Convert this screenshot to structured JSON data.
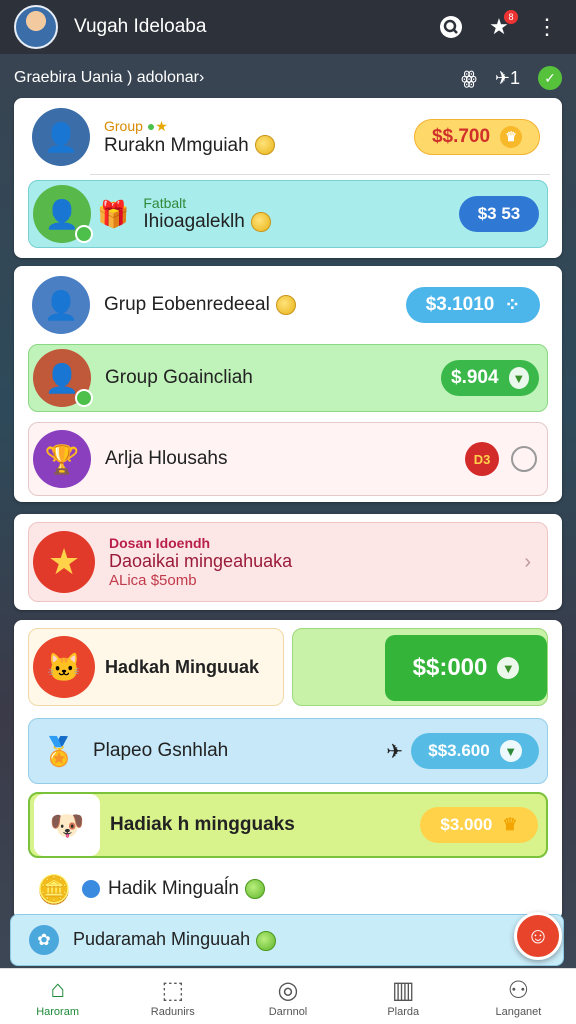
{
  "header": {
    "title": "Vugah Ideloaba",
    "notification_count": "8"
  },
  "subbar": {
    "breadcrumb": "Graebira Uania ) adolonar›",
    "count_a": "",
    "count_b": "1"
  },
  "section1": {
    "row1": {
      "tag": "Group",
      "label": "Rurakn Mmguiah",
      "amount": "$$.700",
      "pill_color": "#ffd86a"
    },
    "row2": {
      "tag": "Fatbalt",
      "label": "Ihioagaleklh",
      "amount": "$3 53",
      "pill_color": "#2f79d4"
    }
  },
  "section2": {
    "row1": {
      "label": "Grup Eobenredeeal",
      "amount": "$3.1010",
      "pill_color": "#4cb6ea"
    },
    "row2": {
      "label": "Group Goaincliah",
      "amount": "$.904",
      "pill_color": "#3bb84a"
    },
    "row3": {
      "label": "Arlja Hlousahs",
      "badge": "D3"
    }
  },
  "promo": {
    "title": "Dosan Idoendh",
    "subtitle": "Daoaikai mingeahuaka",
    "detail": "ALica $5omb"
  },
  "section3": {
    "row1": {
      "label": "Hadkah Minguuak",
      "amount": "$$:000"
    },
    "row2": {
      "label": "Plapeo Gsnhlah",
      "amount": "$$3.600"
    },
    "row3": {
      "label": "Hadiak h mingguaks",
      "amount": "$3.000"
    },
    "row4": {
      "label": "Hadik Minguaĺn"
    },
    "row5": {
      "label": "Pudaramah Minguuah"
    }
  },
  "nav": {
    "items": [
      {
        "label": "Haroram"
      },
      {
        "label": "Radunirs"
      },
      {
        "label": "Darnnol"
      },
      {
        "label": "Plarda"
      },
      {
        "label": "Langanet"
      }
    ]
  },
  "colors": {
    "accent_green": "#3bb84a",
    "topbar": "#2d3139"
  }
}
